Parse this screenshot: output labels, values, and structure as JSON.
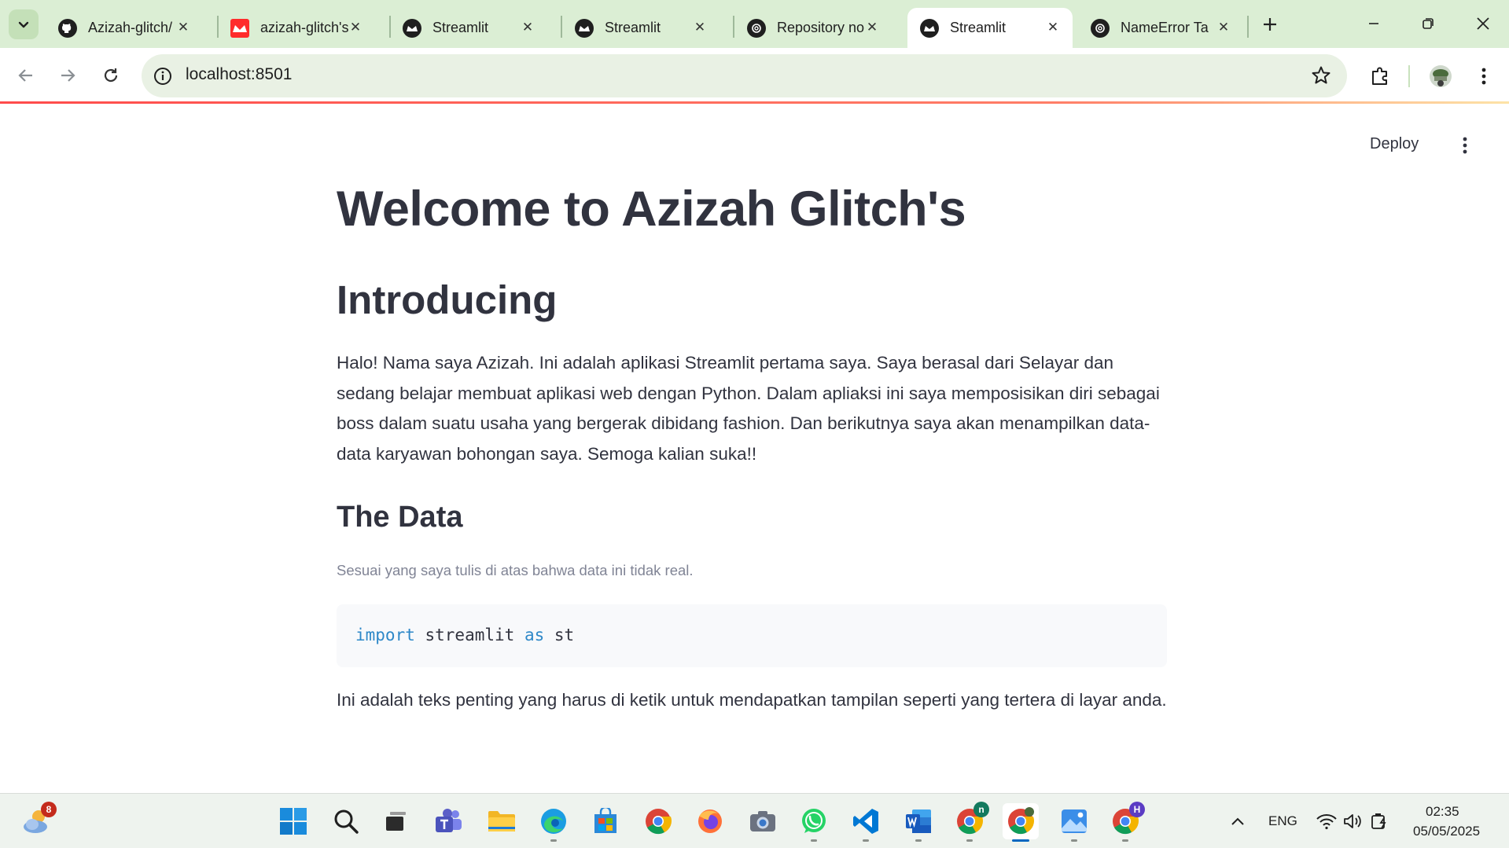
{
  "browser": {
    "tabs": [
      {
        "title": "Azizah-glitch/",
        "icon": "github-icon"
      },
      {
        "title": "azizah-glitch's",
        "icon": "streamlit-red-icon"
      },
      {
        "title": "Streamlit",
        "icon": "streamlit-icon"
      },
      {
        "title": "Streamlit",
        "icon": "streamlit-icon"
      },
      {
        "title": "Repository no",
        "icon": "openai-icon"
      },
      {
        "title": "Streamlit",
        "icon": "streamlit-icon",
        "active": true
      },
      {
        "title": "NameError Ta",
        "icon": "openai-icon"
      }
    ],
    "url": "localhost:8501"
  },
  "app": {
    "deploy_label": "Deploy",
    "title": "Welcome to Azizah Glitch's",
    "header": "Introducing",
    "paragraph": "Halo! Nama saya Azizah. Ini adalah aplikasi Streamlit pertama saya. Saya berasal dari Selayar dan sedang belajar membuat aplikasi web dengan Python. Dalam apliaksi ini saya memposisikan diri sebagai boss dalam suatu usaha yang bergerak dibidang fashion. Dan berikutnya saya akan menampilkan data-data karyawan bohongan saya. Semoga kalian suka!!",
    "subheader": "The Data",
    "caption": "Sesuai yang saya tulis di atas bahwa data ini tidak real.",
    "code": {
      "kw1": "import",
      "mod": " streamlit ",
      "kw2": "as",
      "alias": " st"
    },
    "paragraph2": "Ini adalah teks penting yang harus di ketik untuk mendapatkan tampilan seperti yang tertera di layar anda."
  },
  "taskbar": {
    "weather_badge": "8",
    "chrome_profile_n": "n",
    "chrome_profile_h": "H",
    "language": "ENG",
    "time": "02:35",
    "date": "05/05/2025"
  },
  "colors": {
    "accent": "#ff4b4b",
    "text": "#31333f",
    "caption": "#808495",
    "code_keyword": "#2e88c8",
    "tabstrip": "#dbeed4"
  }
}
